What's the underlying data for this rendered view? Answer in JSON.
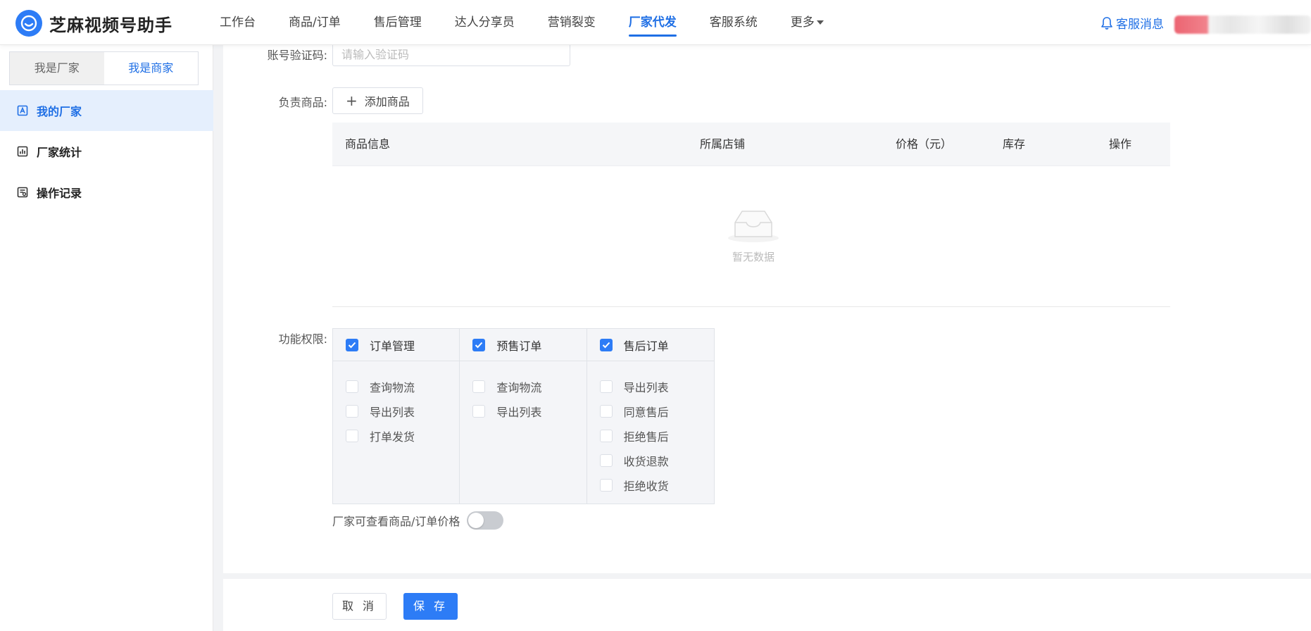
{
  "app": {
    "title": "芝麻视频号助手"
  },
  "nav": {
    "items": [
      {
        "label": "工作台"
      },
      {
        "label": "商品/订单"
      },
      {
        "label": "售后管理"
      },
      {
        "label": "达人分享员"
      },
      {
        "label": "营销裂变"
      },
      {
        "label": "厂家代发"
      },
      {
        "label": "客服系统"
      },
      {
        "label": "更多"
      }
    ],
    "active": "厂家代发",
    "service_label": "客服消息"
  },
  "sidebar": {
    "roles": [
      {
        "label": "我是厂家"
      },
      {
        "label": "我是商家"
      }
    ],
    "selected_role": "我是商家",
    "menu": [
      {
        "label": "我的厂家",
        "icon": "manufacturer-icon"
      },
      {
        "label": "厂家统计",
        "icon": "chart-icon"
      },
      {
        "label": "操作记录",
        "icon": "record-icon"
      }
    ],
    "active_menu": "我的厂家"
  },
  "form": {
    "verify_code": {
      "label": "账号验证码:",
      "placeholder": "请输入验证码",
      "value": ""
    },
    "goods": {
      "label": "负责商品:",
      "add_button": "添加商品",
      "table": {
        "columns": [
          "商品信息",
          "所属店铺",
          "价格（元）",
          "库存",
          "操作"
        ],
        "rows": [],
        "empty_text": "暂无数据"
      }
    },
    "permissions": {
      "label": "功能权限:",
      "groups": [
        {
          "name": "订单管理",
          "checked": true,
          "items": [
            {
              "label": "查询物流",
              "checked": false
            },
            {
              "label": "导出列表",
              "checked": false
            },
            {
              "label": "打单发货",
              "checked": false
            }
          ]
        },
        {
          "name": "预售订单",
          "checked": true,
          "items": [
            {
              "label": "查询物流",
              "checked": false
            },
            {
              "label": "导出列表",
              "checked": false
            }
          ]
        },
        {
          "name": "售后订单",
          "checked": true,
          "items": [
            {
              "label": "导出列表",
              "checked": false
            },
            {
              "label": "同意售后",
              "checked": false
            },
            {
              "label": "拒绝售后",
              "checked": false
            },
            {
              "label": "收货退款",
              "checked": false
            },
            {
              "label": "拒绝收货",
              "checked": false
            }
          ]
        }
      ]
    },
    "price_visible": {
      "label": "厂家可查看商品/订单价格",
      "on": false
    }
  },
  "footer": {
    "cancel_label": "取 消",
    "save_label": "保 存"
  },
  "colors": {
    "primary": "#2d7cf6",
    "active_nav": "#1f6fe5",
    "sidebar_active_bg": "#e5effd"
  }
}
